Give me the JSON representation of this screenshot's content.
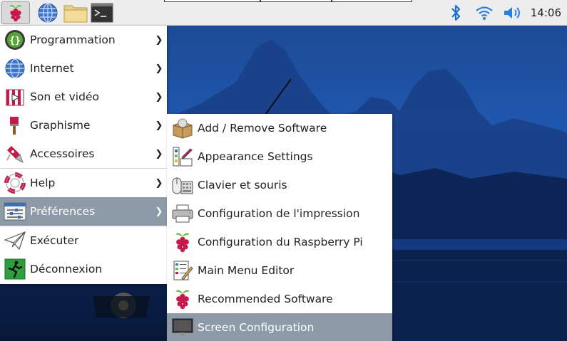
{
  "taskbar": {
    "launchers": [
      {
        "name": "menu-button",
        "icon": "raspberry-icon"
      },
      {
        "name": "web-browser-launcher",
        "icon": "globe-icon"
      },
      {
        "name": "file-manager-launcher",
        "icon": "folder-icon"
      },
      {
        "name": "terminal-launcher",
        "icon": "terminal-icon"
      }
    ],
    "tray": {
      "bluetooth_icon": "bluetooth-icon",
      "wifi_icon": "wifi-icon",
      "volume_icon": "volume-icon"
    },
    "clock": "14:06"
  },
  "main_menu": {
    "items": [
      {
        "label": "Programmation",
        "icon": "code-braces-icon",
        "submenu": true
      },
      {
        "label": "Internet",
        "icon": "globe-icon",
        "submenu": true
      },
      {
        "label": "Son et vidéo",
        "icon": "media-icon",
        "submenu": true
      },
      {
        "label": "Graphisme",
        "icon": "paintbrush-icon",
        "submenu": true
      },
      {
        "label": "Accessoires",
        "icon": "pocket-knife-icon",
        "submenu": true
      },
      {
        "label": "Help",
        "icon": "lifebuoy-icon",
        "submenu": true
      },
      {
        "label": "Préférences",
        "icon": "preferences-icon",
        "submenu": true,
        "selected": true
      },
      {
        "label": "Exécuter",
        "icon": "paper-plane-icon",
        "submenu": false
      },
      {
        "label": "Déconnexion",
        "icon": "exit-icon",
        "submenu": false
      }
    ]
  },
  "preferences_menu": {
    "items": [
      {
        "label": "Add / Remove Software",
        "icon": "package-icon"
      },
      {
        "label": "Appearance Settings",
        "icon": "appearance-icon"
      },
      {
        "label": "Clavier et souris",
        "icon": "keyboard-mouse-icon"
      },
      {
        "label": "Configuration de l'impression",
        "icon": "printer-icon"
      },
      {
        "label": "Configuration du Raspberry Pi",
        "icon": "raspberry-icon"
      },
      {
        "label": "Main Menu Editor",
        "icon": "menu-editor-icon"
      },
      {
        "label": "Recommended Software",
        "icon": "raspberry-icon"
      },
      {
        "label": "Screen Configuration",
        "icon": "monitor-icon",
        "selected": true
      }
    ]
  },
  "colors": {
    "selection": "#8e9aa8",
    "panel": "#ededed",
    "raspberry": "#c51a4a",
    "leaf": "#6cc04a"
  }
}
